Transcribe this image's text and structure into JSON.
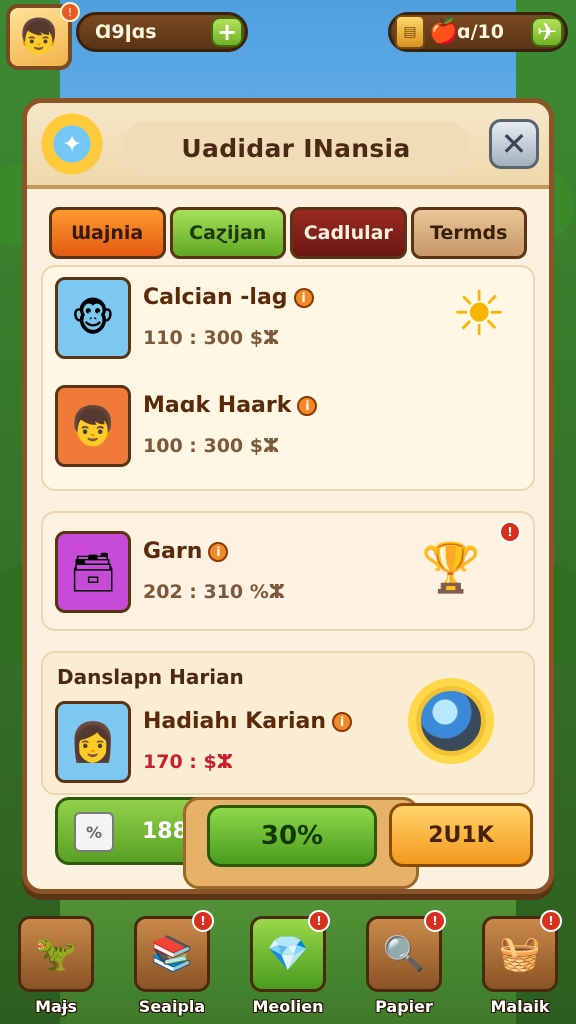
{
  "topbar": {
    "player_name": "Ɑ9ǀɑs",
    "avatar_icon": "boy-avatar-icon",
    "left_plus": "+",
    "right_value": "ɑ/10",
    "right_leaf": "✈",
    "avatar_badge": "!"
  },
  "panel": {
    "title": "Uadidar INansia",
    "close": "✕",
    "tabs": [
      "Ɯajnia",
      "Caɀijan",
      "Cadlular",
      "Termds"
    ],
    "items": [
      {
        "name": "Calcian -lag",
        "stats": "110 : 300 $ⵣ",
        "icon": "🐵"
      },
      {
        "name": "Maɑk Haark",
        "stats": "100 : 300 $ⵣ",
        "icon": "👦"
      },
      {
        "name": "Garn",
        "stats": "202 : 310 %ⵣ",
        "icon": "🗃"
      }
    ],
    "section_title": "Danslapn Harian",
    "section_item": {
      "name": "Hadiahı Karian",
      "stats": "170 : $ⵣ",
      "icon": "👩"
    },
    "gem_icon": "gem-icon",
    "buttons": {
      "gray": "188",
      "green": "30%",
      "orange": "2U1K"
    },
    "info_symbol": "i",
    "badge_symbol": "!"
  },
  "nav": [
    {
      "label": "Maɉs",
      "icon": "🦖",
      "badge": ""
    },
    {
      "label": "Seaipla",
      "icon": "📚",
      "badge": "!"
    },
    {
      "label": "Meolien",
      "icon": "💎",
      "badge": "!"
    },
    {
      "label": "Papier",
      "icon": "🔍",
      "badge": "!"
    },
    {
      "label": "Malaik",
      "icon": "🧺",
      "badge": "!"
    }
  ],
  "colors": {
    "panel_border": "#8a5426",
    "tab_active": "#e35a12",
    "green": "#5aa026",
    "orange": "#f39a1e"
  }
}
